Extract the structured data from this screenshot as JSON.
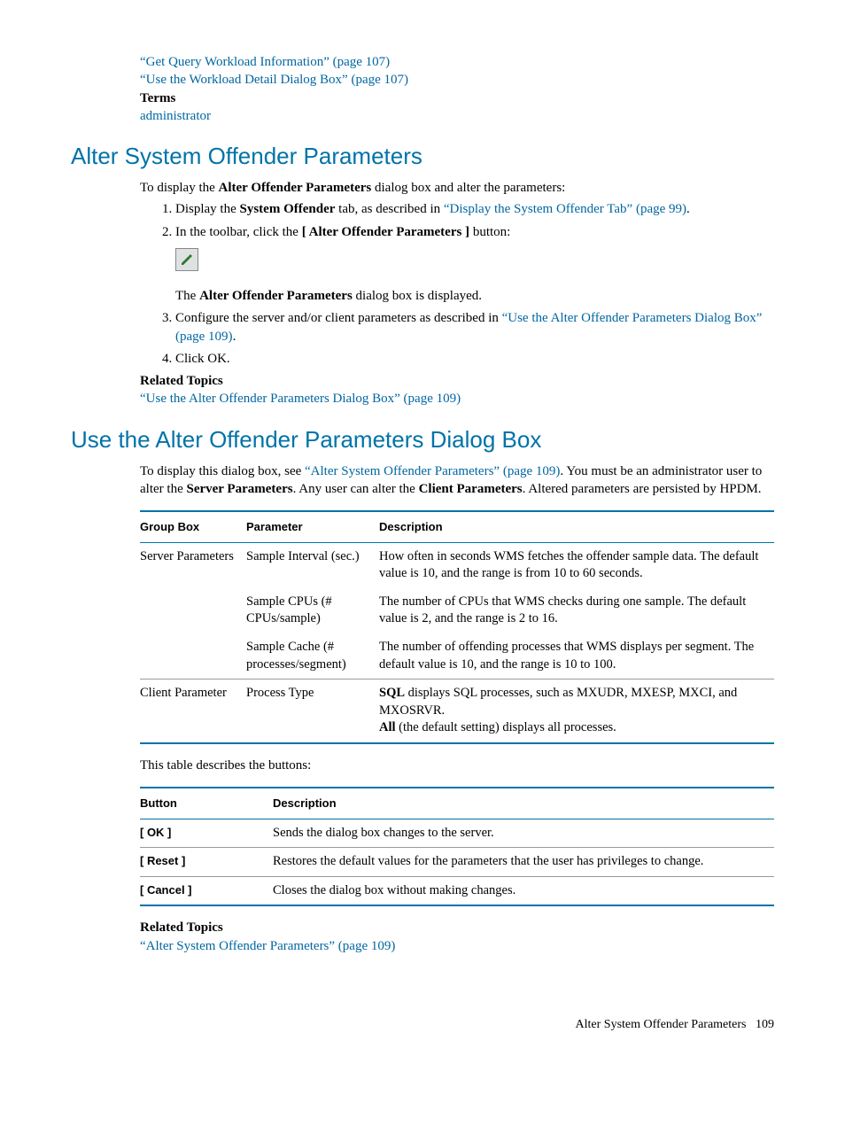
{
  "top": {
    "link1": "“Get Query Workload Information” (page 107)",
    "link2": "“Use the Workload Detail Dialog Box” (page 107)",
    "terms_label": "Terms",
    "terms_value": "administrator"
  },
  "section1": {
    "heading": "Alter System Offender Parameters",
    "intro_pre": "To display the ",
    "intro_bold": "Alter Offender Parameters",
    "intro_post": " dialog box and alter the parameters:",
    "step1_pre": "Display the ",
    "step1_bold": "System Offender",
    "step1_mid": " tab, as described in ",
    "step1_link": "“Display the System Offender Tab” (page 99)",
    "step1_end": ".",
    "step2_pre": "In the toolbar, click the ",
    "step2_bold": "[ Alter Offender Parameters ]",
    "step2_post": " button:",
    "after_icon_pre": "The ",
    "after_icon_bold": "Alter Offender Parameters",
    "after_icon_post": " dialog box is displayed.",
    "step3_pre": "Configure the server and/or client parameters as described in ",
    "step3_link": "“Use the Alter Offender Parameters Dialog Box” (page 109)",
    "step3_end": ".",
    "step4": "Click OK.",
    "related_label": "Related Topics",
    "related_link": "“Use the Alter Offender Parameters Dialog Box” (page 109)"
  },
  "section2": {
    "heading": "Use the Alter Offender Parameters Dialog Box",
    "p1_pre": "To display this dialog box, see ",
    "p1_link": "“Alter System Offender Parameters” (page 109)",
    "p1_mid": ". You must be an administrator user to alter the ",
    "p1_bold1": "Server Parameters",
    "p1_mid2": ". Any user can alter the ",
    "p1_bold2": "Client Parameters",
    "p1_end": ". Altered parameters are persisted by HPDM.",
    "table1": {
      "h1": "Group Box",
      "h2": "Parameter",
      "h3": "Description",
      "rows": [
        {
          "group": "Server Parameters",
          "param": "Sample Interval (sec.)",
          "desc": "How often in seconds WMS fetches the offender sample data. The default value is 10, and the range is from 10 to 60 seconds."
        },
        {
          "group": "",
          "param": "Sample CPUs (# CPUs/sample)",
          "desc": "The number of CPUs that WMS checks during one sample. The default value is 2, and the range is 2 to 16."
        },
        {
          "group": "",
          "param": "Sample Cache (# processes/segment)",
          "desc": "The number of offending processes that WMS displays per segment. The default value is 10, and the range is 10 to 100."
        }
      ],
      "row4_group": "Client Parameter",
      "row4_param": "Process Type",
      "row4_b1": "SQL",
      "row4_t1": " displays SQL processes, such as MXUDR, MXESP, MXCI, and MXOSRVR.",
      "row4_b2": "All",
      "row4_t2": " (the default setting) displays all processes."
    },
    "between": "This table describes the buttons:",
    "table2": {
      "h1": "Button",
      "h2": "Description",
      "rows": [
        {
          "btn": "[ OK ]",
          "desc": "Sends the dialog box changes to the server."
        },
        {
          "btn": "[ Reset ]",
          "desc": "Restores the default values for the parameters that the user has privileges to change."
        },
        {
          "btn": "[ Cancel ]",
          "desc": "Closes the dialog box without making changes."
        }
      ]
    },
    "related_label": "Related Topics",
    "related_link": "“Alter System Offender Parameters” (page 109)"
  },
  "footer": {
    "text": "Alter System Offender Parameters",
    "page": "109"
  }
}
